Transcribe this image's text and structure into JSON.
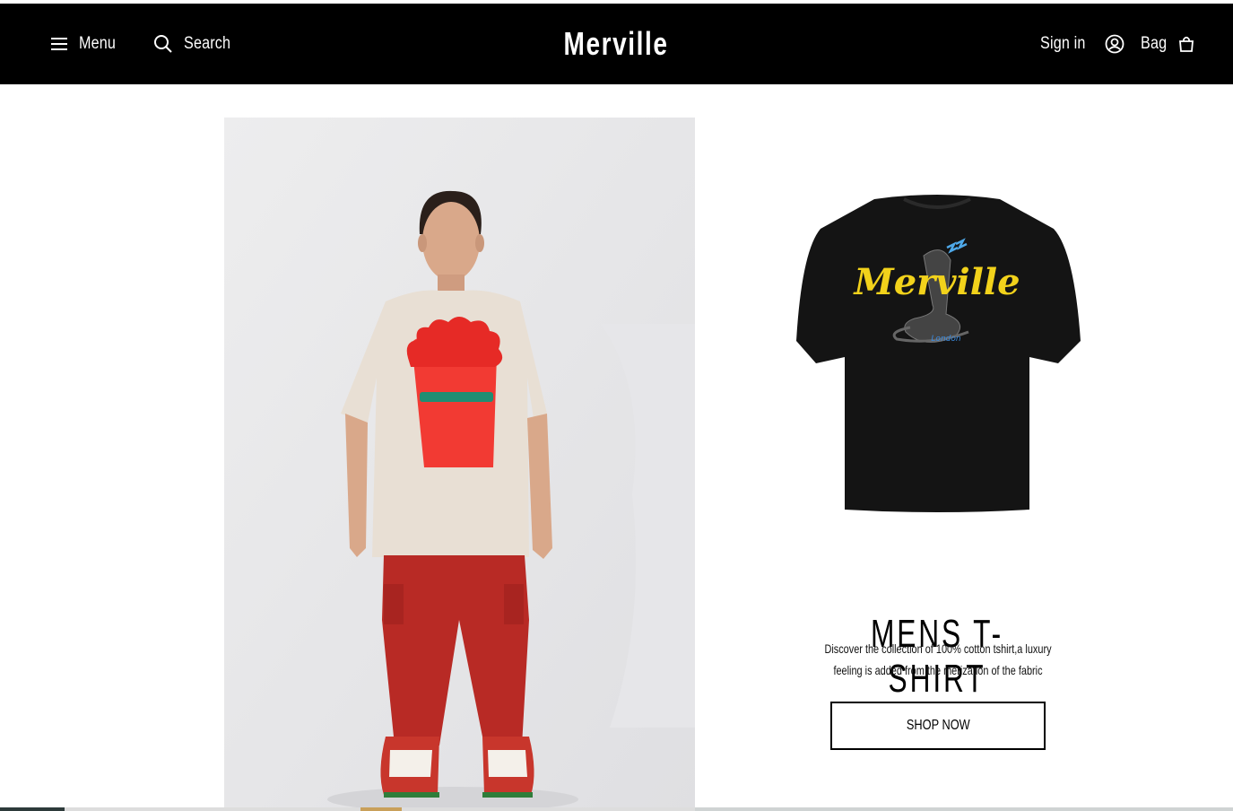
{
  "header": {
    "menu_label": "Menu",
    "search_label": "Search",
    "logo": "Merville",
    "signin_label": "Sign in",
    "bag_label": "Bag",
    "icons": {
      "menu": "hamburger-icon",
      "search": "search-icon",
      "account": "user-circle-icon",
      "bag": "shopping-bag-icon"
    }
  },
  "hero": {
    "model_image": "model-wearing-red-face-tshirt",
    "product_image": "black-merville-cobra-tshirt",
    "product_print_text": "Merville",
    "product_print_subtext": "London"
  },
  "promo": {
    "title": "MENS T-SHIRT",
    "description": "Discover the collection of 100% cotton tshirt,a luxury feeling is added from the merization of the fabric",
    "button_label": "SHOP NOW"
  },
  "colors": {
    "header_bg": "#000000",
    "header_text": "#ffffff",
    "page_bg": "#ffffff",
    "print_yellow": "#f2d21b",
    "pants_red": "#b82a25"
  }
}
